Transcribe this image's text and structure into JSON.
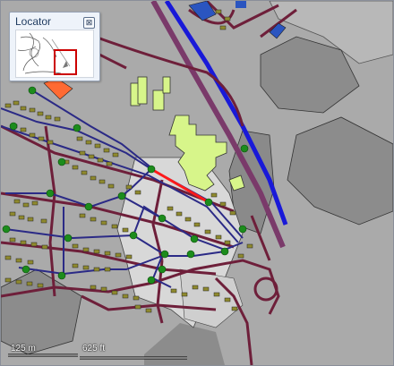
{
  "locator": {
    "title": "Locator",
    "close_symbol": "⊠"
  },
  "scalebar": {
    "metric_label": "125 m",
    "imperial_label": "625 ft"
  },
  "colors": {
    "background": "#aaaaaa",
    "dark_gray_area": "#8c8c8c",
    "light_area": "#d8d8d8",
    "building": "#8f8a2e",
    "highlight_building": "#d7f58a",
    "blue_building": "#2a55c0",
    "orange_building": "#ff6a33",
    "main_road": "#6e1f3a",
    "road_casing": "#4a1020",
    "network_line": "#2b2a86",
    "highway": "#1919d8",
    "highlight_segment": "#ff1a1a",
    "junction": "#1c8c1c"
  }
}
